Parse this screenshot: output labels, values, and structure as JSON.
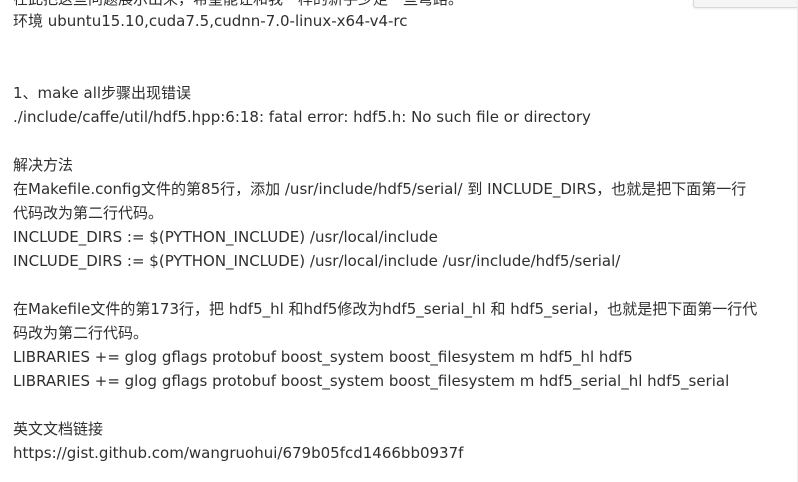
{
  "article": {
    "top_cut_line": "在此把这些问题展示出来，希望能让和我一样的新手少走一些弯路。",
    "env_line": "环境 ubuntu15.10,cuda7.5,cudnn-7.0-linux-x64-v4-rc",
    "step_heading": "1、make all步骤出现错误",
    "error_line": "./include/caffe/util/hdf5.hpp:6:18: fatal error: hdf5.h: No such file or directory",
    "solution_heading": "解决方法",
    "fix1_line1": "在Makefile.config文件的第85行，添加 /usr/include/hdf5/serial/ 到 INCLUDE_DIRS，也就是把下面第一行",
    "fix1_line2": "代码改为第二行代码。",
    "code1_a": "INCLUDE_DIRS := $(PYTHON_INCLUDE) /usr/local/include",
    "code1_b": "INCLUDE_DIRS := $(PYTHON_INCLUDE) /usr/local/include /usr/include/hdf5/serial/",
    "fix2_line1": "在Makefile文件的第173行，把 hdf5_hl 和hdf5修改为hdf5_serial_hl 和 hdf5_serial，也就是把下面第一行代",
    "fix2_line2": "码改为第二行代码。",
    "code2_a": "LIBRARIES += glog gflags protobuf boost_system boost_filesystem m hdf5_hl hdf5",
    "code2_b": "LIBRARIES += glog gflags protobuf boost_system boost_filesystem m hdf5_serial_hl hdf5_serial",
    "doc_heading": "英文文档链接",
    "doc_link": "https://gist.github.com/wangruohui/679b05fcd1466bb0937f"
  }
}
